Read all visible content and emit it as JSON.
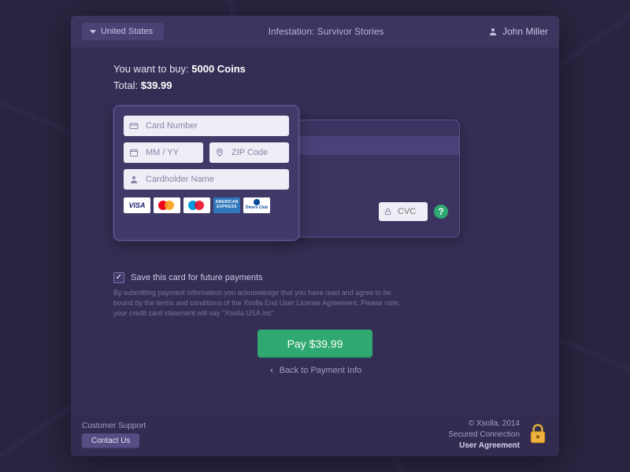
{
  "header": {
    "country": "United States",
    "title": "Infestation: Survivor Stories",
    "user_name": "John Miller"
  },
  "purchase": {
    "want_to_buy_prefix": "You want to buy: ",
    "item": "5000 Coins",
    "total_prefix": "Total: ",
    "total": "$39.99"
  },
  "card_form": {
    "number_placeholder": "Card Number",
    "expiry_placeholder": "MM / YY",
    "zip_placeholder": "ZIP Code",
    "name_placeholder": "Cardholder Name",
    "cvc_placeholder": "CVC",
    "brands": [
      "VISA",
      "MasterCard",
      "Maestro",
      "American Express",
      "Diners Club"
    ]
  },
  "save_card": {
    "checked": true,
    "label": "Save this card for future payments"
  },
  "disclaimer": "By submitting payment information you acknowledge that you have read and agree to be bound by the terms and conditions of the Xsolla End User License Agreement. Please note, your credit card statement will say \"Xsolla USA Inc\"",
  "actions": {
    "pay_label": "Pay $39.99",
    "back_label": "Back to Payment Info"
  },
  "footer": {
    "support_label": "Customer Support",
    "contact_label": "Contact Us",
    "copyright": "© Xsolla, 2014",
    "secured": "Secured Connection",
    "user_agreement": "User Agreement"
  },
  "colors": {
    "accent_green": "#2fa871",
    "panel": "#352e54"
  }
}
